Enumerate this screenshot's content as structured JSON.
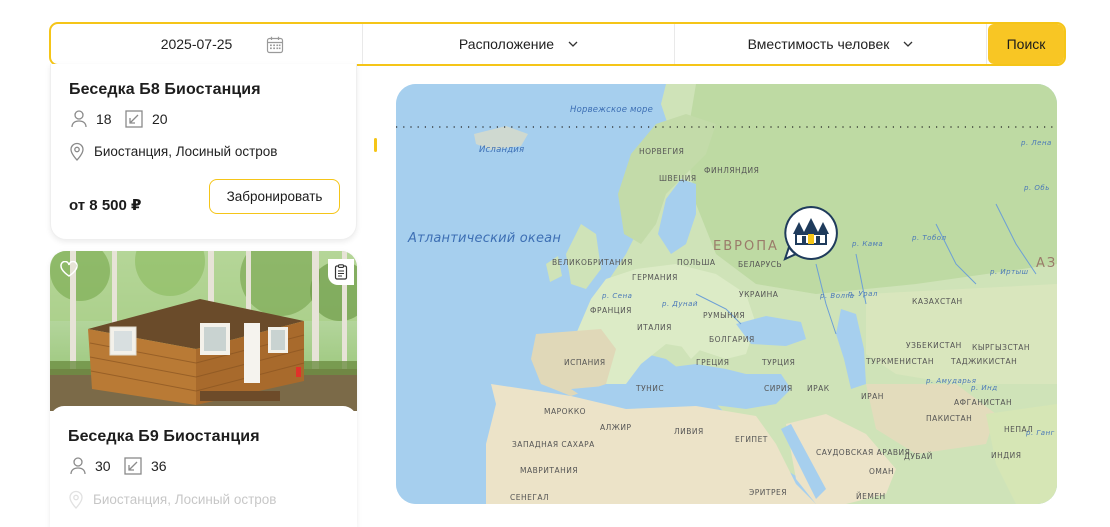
{
  "search": {
    "date": "2025-07-25",
    "location_label": "Расположение",
    "capacity_label": "Вместимость человек",
    "search_button": "Поиск"
  },
  "cards": [
    {
      "title": "Беседка Б8 Биостанция",
      "guests": "18",
      "area": "20",
      "location": "Биостанция, Лосиный остров",
      "price": "от 8 500 ₽",
      "book_button": "Забронировать"
    },
    {
      "title": "Беседка Б9 Биостанция",
      "guests": "30",
      "area": "36",
      "location": "Биостанция, Лосиный остров"
    }
  ],
  "map": {
    "seas": {
      "norwegian": "Норвежское море",
      "atlantic": "Атлантический океан",
      "iceland": "Исландия"
    },
    "continent": "ЕВРОПА",
    "continent2": "АЗ",
    "countries": [
      "НОРВЕГИЯ",
      "ФИНЛЯНДИЯ",
      "ШВЕЦИЯ",
      "ВЕЛИКОБРИТАНИЯ",
      "ГЕРМАНИЯ",
      "ПОЛЬША",
      "БЕЛАРУСЬ",
      "УКРАИНА",
      "ФРАНЦИЯ",
      "ИТАЛИЯ",
      "РУМЫНИЯ",
      "БОЛГАРИЯ",
      "ИСПАНИЯ",
      "ГРЕЦИЯ",
      "ТУРЦИЯ",
      "КАЗАХСТАН",
      "УЗБЕКИСТАН",
      "КЫРГЫЗСТАН",
      "ТУРКМЕНИСТАН",
      "ТАДЖИКИСТАН",
      "ИРАН",
      "ИРАК",
      "СИРИЯ",
      "ТУНИС",
      "МАРОККО",
      "АЛЖИР",
      "ЛИВИЯ",
      "ЕГИПЕТ",
      "ЗАПАДНАЯ САХАРА",
      "МАВРИТАНИЯ",
      "САУДОВСКАЯ АРАВИЯ",
      "ОМАН",
      "АФГАНИСТАН",
      "ПАКИСТАН",
      "НЕПАЛ",
      "ИНДИЯ",
      "СЕНЕГАЛ",
      "ЭРИТРЕЯ",
      "ЙЕМЕН",
      "ДУБАЙ"
    ],
    "rivers": [
      "р. Сена",
      "р. Дунай",
      "р. Волга",
      "р. Урал",
      "р. Кама",
      "р. Тобол",
      "р. Иртыш",
      "р. Обь",
      "р. Лена",
      "р. Амударья",
      "р. Инд",
      "р. Ганг"
    ]
  }
}
